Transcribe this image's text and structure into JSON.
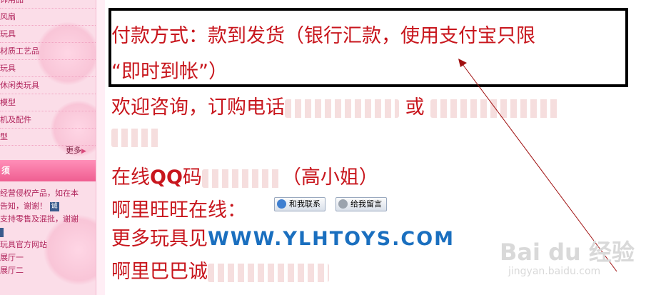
{
  "sidebar": {
    "items": [
      "饰用品",
      "风扇",
      "玩具",
      "材质工艺品",
      "玩具",
      "休闲类玩具",
      "模型",
      "机及配件",
      "型"
    ],
    "more_label": "更多",
    "section_label": "须",
    "notice_lines": [
      "经营侵权产品，如在本",
      "告知，谢谢！",
      "支持零售及混批，谢谢",
      "玩具官方网站",
      "展厅一",
      "展厅二"
    ],
    "notice_icon_text": "诚"
  },
  "main": {
    "payment_line1": "付款方式：款到发货（银行汇款，使用支付宝只限",
    "payment_line2": "“即时到帐”）",
    "consult_prefix": "欢迎咨询，订购电话",
    "consult_or": "或",
    "qq_prefix": "在线",
    "qq_label": "QQ",
    "qq_mid": "码",
    "qq_suffix": "（高小姐）",
    "wangwang_label": "啊里旺旺在线：",
    "btn_contact": "和我联系",
    "btn_message": "给我留言",
    "more_toys_prefix": "更多玩具见",
    "more_toys_url": "WWW.YLHTOYS.COM",
    "alibaba_label": "啊里巴巴诚"
  },
  "watermark": {
    "brand": "Bai du 经验",
    "site": "jingyan.baidu.com"
  },
  "colors": {
    "main_text": "#c8161d",
    "sidebar_bg": "#fbdde8",
    "url": "#1a6fbf"
  }
}
